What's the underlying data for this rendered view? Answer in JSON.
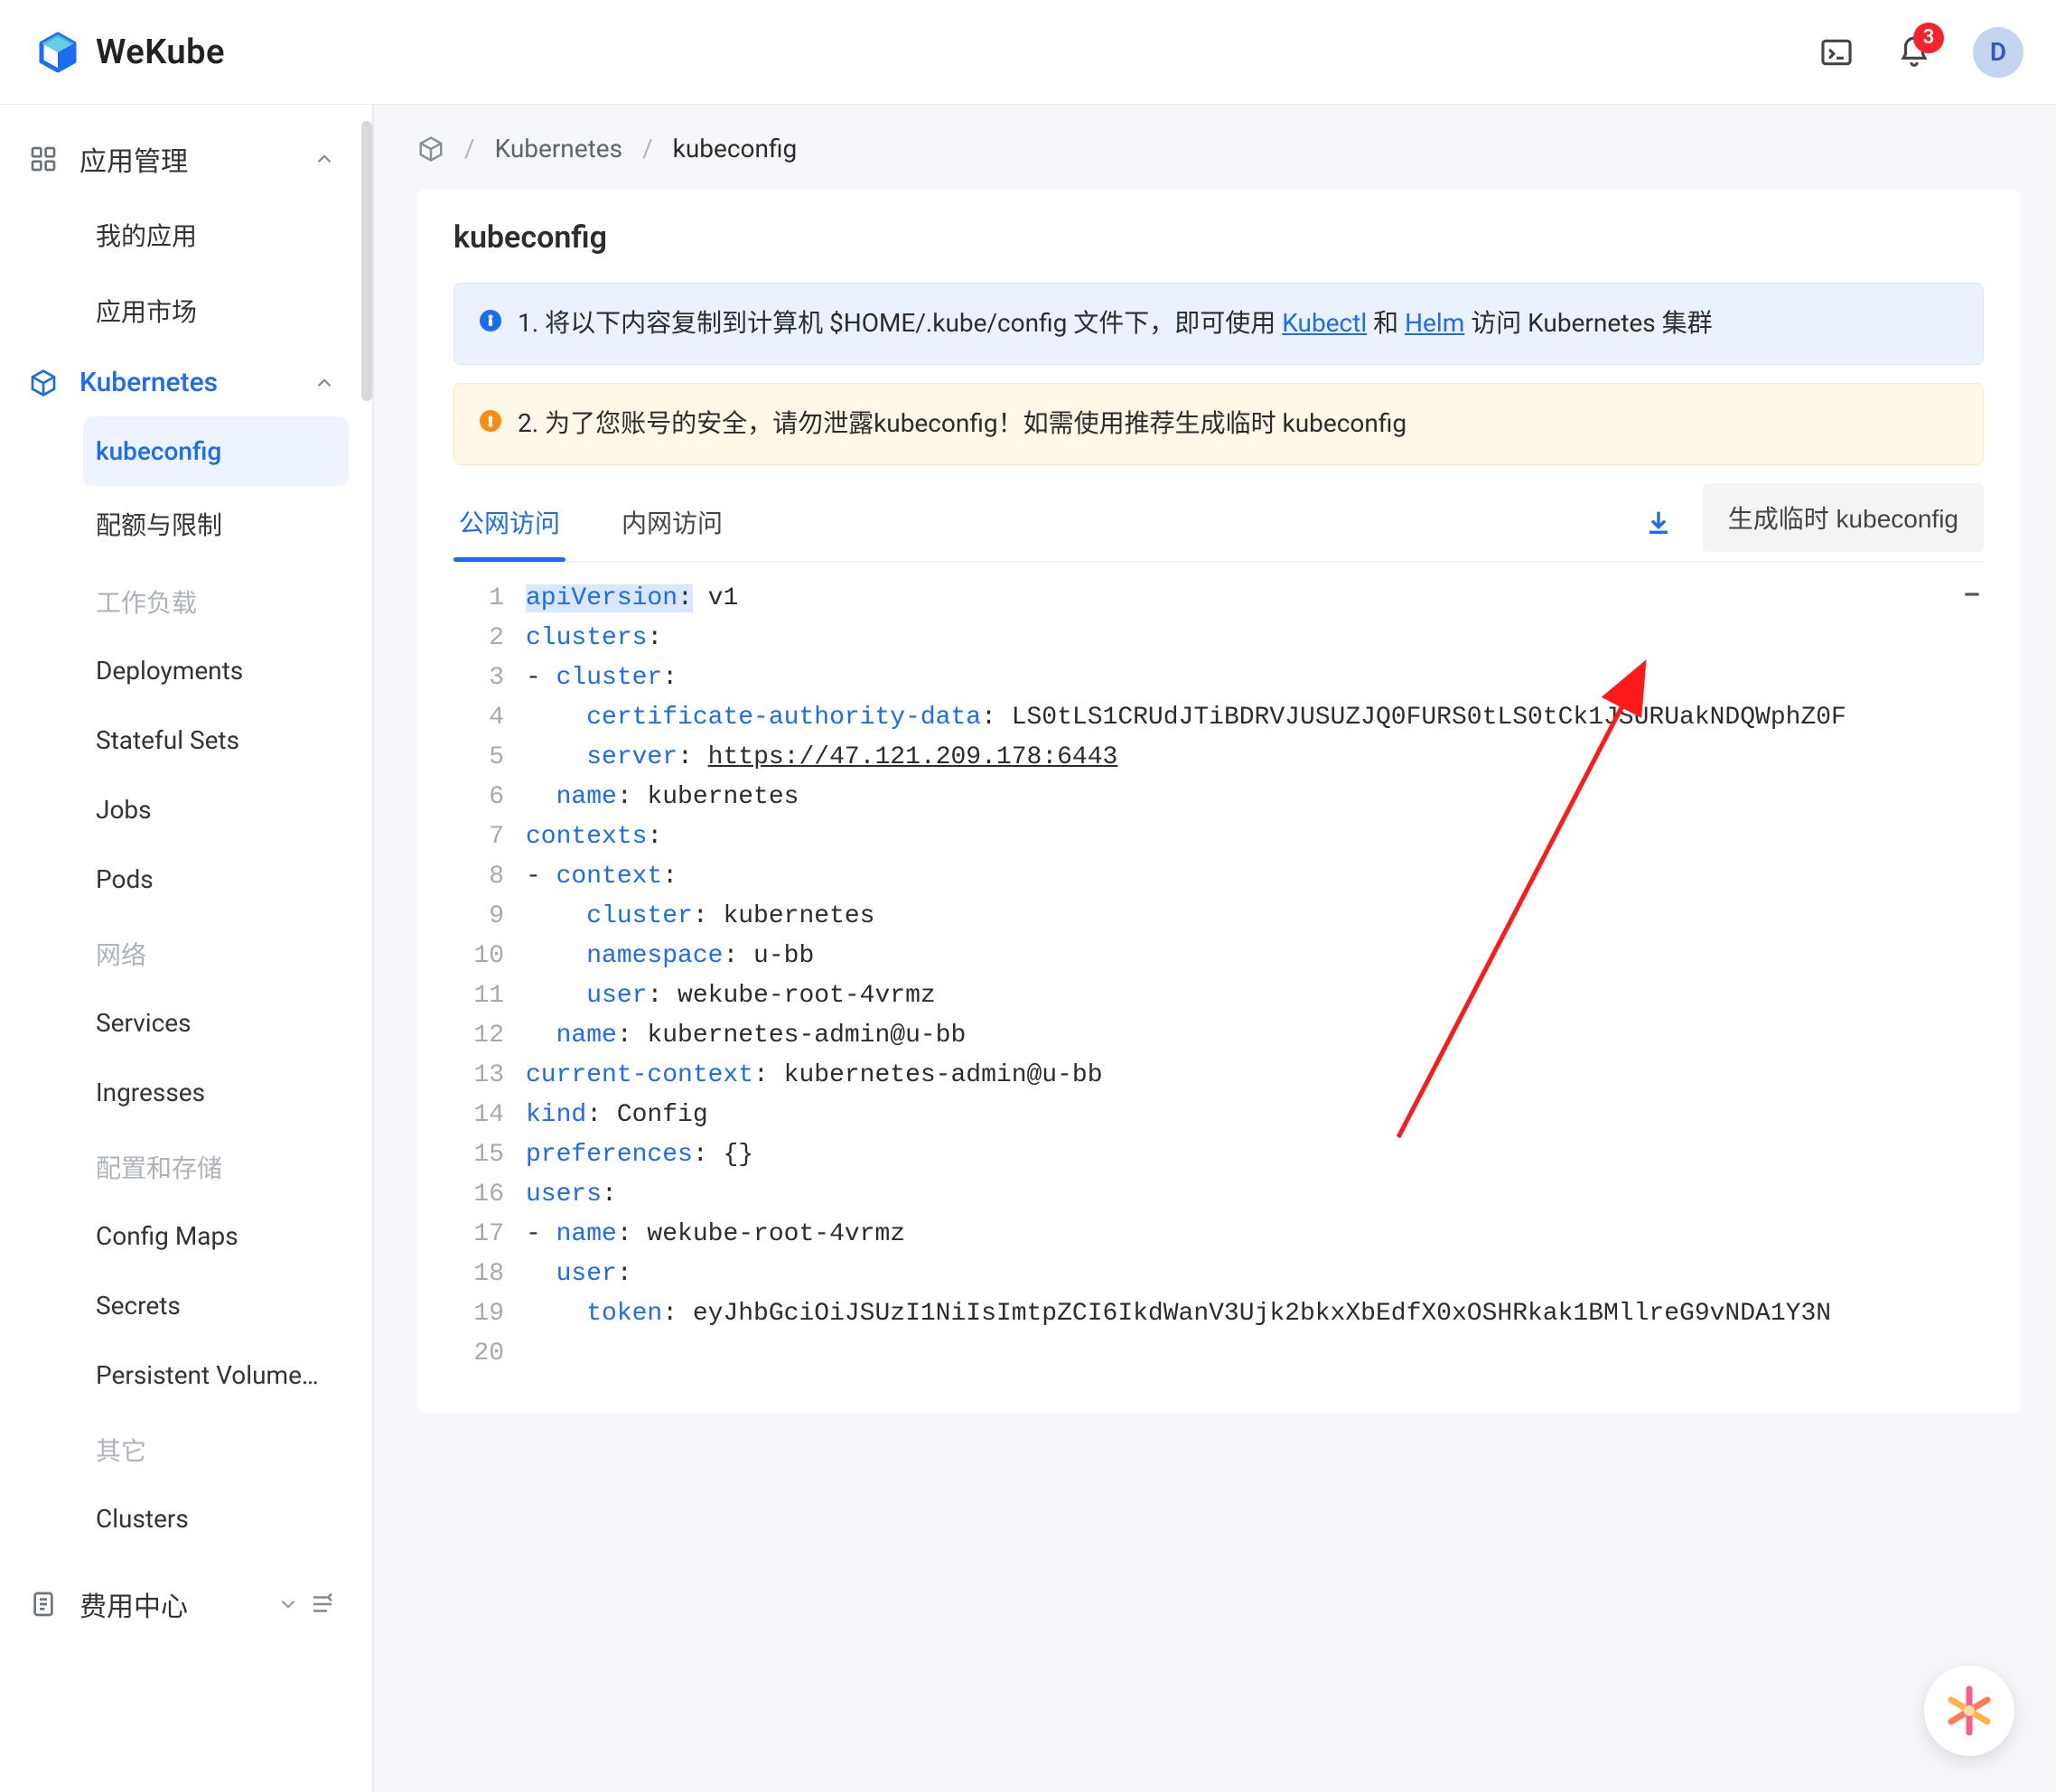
{
  "brand": {
    "name": "WeKube"
  },
  "header": {
    "notifications_count": "3",
    "avatar_initial": "D"
  },
  "sidebar": {
    "groups": {
      "apps": {
        "label": "应用管理",
        "open": true
      },
      "k8s": {
        "label": "Kubernetes",
        "open": true
      },
      "billing": {
        "label": "费用中心"
      }
    },
    "apps_items": {
      "myapps": "我的应用",
      "market": "应用市场"
    },
    "k8s_items": {
      "kubeconfig": "kubeconfig",
      "quota": "配额与限制",
      "sec_work": "工作负载",
      "deployments": "Deployments",
      "statefulsets": "Stateful Sets",
      "jobs": "Jobs",
      "pods": "Pods",
      "sec_net": "网络",
      "services": "Services",
      "ingresses": "Ingresses",
      "sec_cfg": "配置和存储",
      "configmaps": "Config Maps",
      "secrets": "Secrets",
      "pvcs": "Persistent Volume…",
      "sec_other": "其它",
      "clusters": "Clusters"
    }
  },
  "breadcrumb": {
    "a": "Kubernetes",
    "b": "kubeconfig"
  },
  "card": {
    "title": "kubeconfig",
    "alert1_pre": "1. 将以下内容复制到计算机 $HOME/.kube/config 文件下，即可使用 ",
    "alert1_link1": "Kubectl",
    "alert1_mid": " 和 ",
    "alert1_link2": "Helm",
    "alert1_post": " 访问 Kubernetes 集群",
    "alert2": "2. 为了您账号的安全，请勿泄露kubeconfig！如需使用推荐生成临时 kubeconfig",
    "tabs": {
      "public": "公网访问",
      "private": "内网访问"
    },
    "gen_btn": "生成临时 kubeconfig"
  },
  "code": {
    "server_url": "https://47.121.209.178:6443",
    "cert_data": "LS0tLS1CRUdJTiBDRVJUSUZJQ0FURS0tLS0tCk1JSURUakNDQWphZ0F",
    "namespace": "u-bb",
    "user": "wekube-root-4vrmz",
    "ctx_name": "kubernetes-admin@u-bb",
    "cluster_name": "kubernetes",
    "token": "eyJhbGciOiJSUzI1NiIsImtpZCI6IkdWanV3Ujk2bkxXbEdfX0xOSHRkak1BMllreG9vNDA1Y3N"
  }
}
